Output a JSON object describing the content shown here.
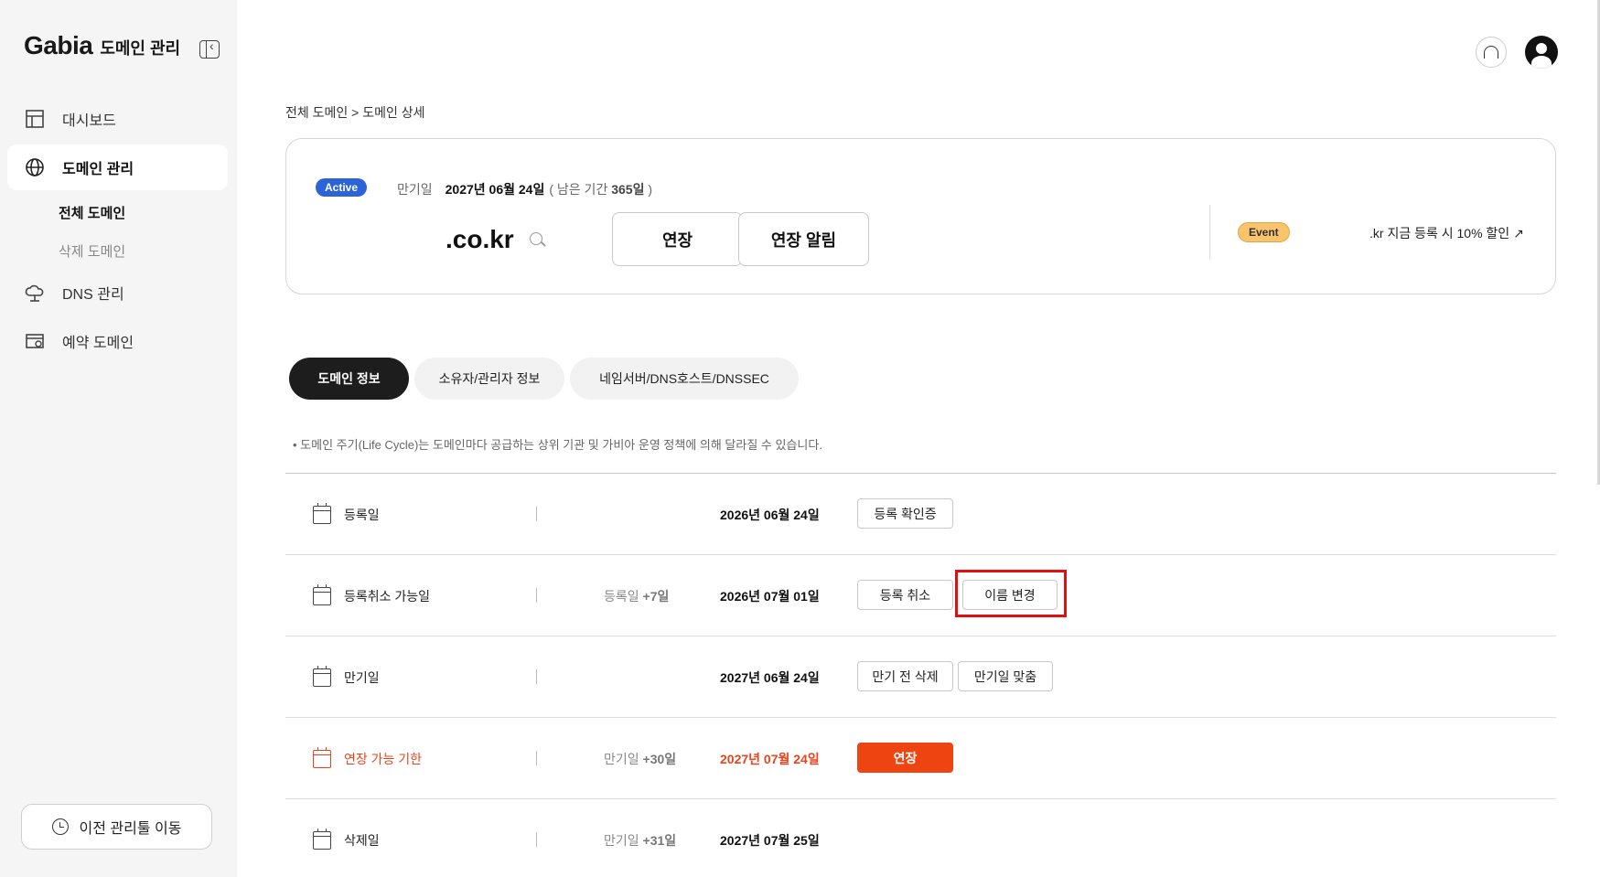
{
  "sidebar": {
    "brand": "Gabia",
    "brand_sub": "도메인 관리",
    "items": [
      {
        "label": "대시보드"
      },
      {
        "label": "도메인 관리"
      },
      {
        "label": "DNS 관리"
      },
      {
        "label": "예약 도메인"
      }
    ],
    "sub_items": [
      {
        "label": "전체 도메인"
      },
      {
        "label": "삭제 도메인"
      }
    ],
    "legacy_button": "이전 관리툴 이동"
  },
  "breadcrumb": "전체 도메인 > 도메인 상세",
  "card": {
    "status": "Active",
    "expiry_label": "만기일",
    "expiry_date": "2027년 06월 24일",
    "remain_prefix": "( 남은 기간 ",
    "remain_value": "365일",
    "remain_suffix": " )",
    "domain": ".co.kr",
    "renew_button": "연장",
    "renew_alert_button": "연장 알림",
    "event_badge": "Event",
    "promo_text": ".kr 지금 등록 시 10% 할인 ↗"
  },
  "tabs": [
    {
      "label": "도메인 정보"
    },
    {
      "label": "소유자/관리자 정보"
    },
    {
      "label": "네임서버/DNS호스트/DNSSEC"
    }
  ],
  "note": "• 도메인 주기(Life Cycle)는 도메인마다 공급하는 상위 기관 및 가비아 운영 정책에 의해 달라질 수 있습니다.",
  "rows": [
    {
      "label": "등록일",
      "offset_prefix": "",
      "offset_value": "",
      "date": "2026년 06월 24일",
      "buttons": [
        "등록 확인증"
      ]
    },
    {
      "label": "등록취소 가능일",
      "offset_prefix": "등록일 ",
      "offset_value": "+7일",
      "date": "2026년 07월 01일",
      "buttons": [
        "등록 취소",
        "이름 변경"
      ]
    },
    {
      "label": "만기일",
      "offset_prefix": "",
      "offset_value": "",
      "date": "2027년 06월 24일",
      "buttons": [
        "만기 전 삭제",
        "만기일 맞춤"
      ]
    },
    {
      "label": "연장 가능 기한",
      "offset_prefix": "만기일 ",
      "offset_value": "+30일",
      "date": "2027년 07월 24일",
      "buttons": [
        "연장"
      ]
    },
    {
      "label": "삭제일",
      "offset_prefix": "만기일 ",
      "offset_value": "+31일",
      "date": "2027년 07월 25일",
      "buttons": []
    }
  ],
  "colors": {
    "accent": "#ee4411",
    "active_badge": "#2b63d9",
    "event_badge": "#f9c46b",
    "focus_box": "#e01010"
  },
  "icons": [
    "collapse-sidebar-icon",
    "dashboard-icon",
    "globe-icon",
    "cloud-dns-icon",
    "reserved-domain-icon",
    "history-icon",
    "headset-icon",
    "user-avatar",
    "search-icon",
    "calendar-icon"
  ]
}
